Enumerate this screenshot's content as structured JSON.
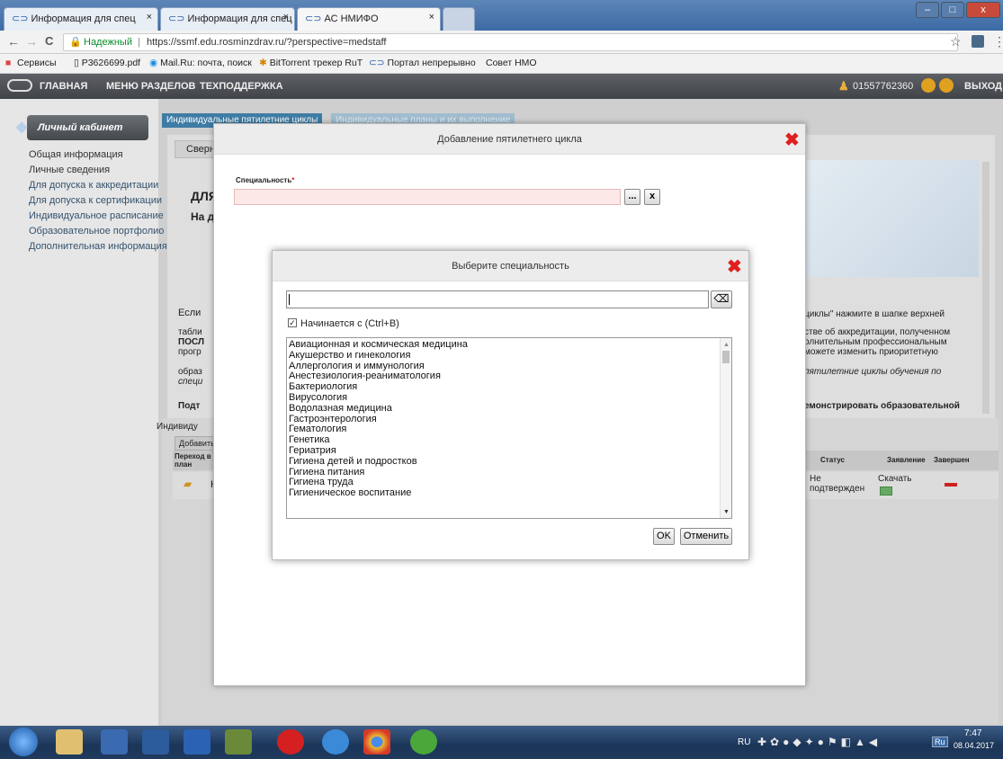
{
  "browser": {
    "tabs": [
      {
        "label": "Информация для спец",
        "close": "×"
      },
      {
        "label": "Информация для спец",
        "close": "×"
      },
      {
        "label": "АС НМИФО",
        "close": "×"
      }
    ],
    "secure_label": "Надежный",
    "url": "https://ssmf.edu.rosminzdrav.ru/?perspective=medstaff",
    "nav": {
      "back": "←",
      "forward": "→",
      "reload": "C",
      "star": "☆",
      "menu": "⋮"
    },
    "window": {
      "minimize": "–",
      "maximize": "□",
      "close": "x"
    }
  },
  "bookmarks": [
    "Сервисы",
    "P3626699.pdf",
    "Mail.Ru: почта, поиск",
    "BitTorrent трекер RuT",
    "Портал непрерывно",
    "Совет НМО"
  ],
  "site_header": {
    "nav": [
      "ГЛАВНАЯ",
      "МЕНЮ РАЗДЕЛОВ",
      "ТЕХПОДДЕРЖКА"
    ],
    "user_id": "01557762360",
    "logout": "ВЫХОД"
  },
  "sidebar": {
    "cabinet_label": "Личный кабинет",
    "items": [
      "Общая информация",
      "Личные сведения",
      "Для допуска к аккредитации",
      "Для допуска к сертификации",
      "Индивидуальное расписание",
      "Образовательное портфолио",
      "Дополнительная информация"
    ]
  },
  "page_tabs": [
    "Индивидуальные пятилетние циклы",
    "Индивидуальные планы и их выполнение"
  ],
  "background_content": {
    "subtab": "Сверн",
    "heading_fragment": "ДЛЯ",
    "subheading_fragment": "На д",
    "para_start": "Если",
    "para_line2": "табли",
    "para_line3": "ПОСЛ",
    "para_line4": "прогр",
    "para_line5": "образ",
    "para_line6": "специ",
    "para_line7": "Подт",
    "right_text_1": "циклы\" нажмите в шапке верхней",
    "right_text_2": "стве об аккредитации, полученном",
    "right_text_3": "олнительным профессиональным",
    "right_text_4": "можете изменить приоритетную",
    "right_text_5": "пятилетние циклы обучения по",
    "right_text_6": "емонстрировать образовательной",
    "lower_title": "Индивиду",
    "add_button": "Добавить",
    "col_transfer": "Переход в план",
    "col_status": "Статус",
    "col_application": "Заявление",
    "col_finished": "Завершен",
    "row_status": "Не подтвержден",
    "row_download": "Скачать",
    "row_k": "К"
  },
  "dialog_cycle": {
    "title": "Добавление пятилетнего цикла",
    "field_label": "Специальность",
    "required_mark": "*",
    "browse_btn": "...",
    "clear_btn": "x"
  },
  "dialog_specialty": {
    "title": "Выберите специальность",
    "search_value": "",
    "checkbox_label": "Начинается с (Ctrl+B)",
    "checkbox_checked": true,
    "specialties": [
      "Авиационная и космическая медицина",
      "Акушерство и гинекология",
      "Аллергология и иммунология",
      "Анестезиология-реаниматология",
      "Бактериология",
      "Вирусология",
      "Водолазная медицина",
      "Гастроэнтерология",
      "Гематология",
      "Генетика",
      "Гериатрия",
      "Гигиена детей и подростков",
      "Гигиена питания",
      "Гигиена труда",
      "Гигиеническое воспитание"
    ],
    "ok_btn": "OK",
    "cancel_btn": "Отменить"
  },
  "taskbar": {
    "lang": "RU",
    "lang2": "Ru",
    "time": "7:47",
    "date": "08.04.2017"
  },
  "colors": {
    "close_red": "#e02020",
    "tab_blue": "#3e7ca5",
    "required_field_bg": "#fde8e8"
  }
}
